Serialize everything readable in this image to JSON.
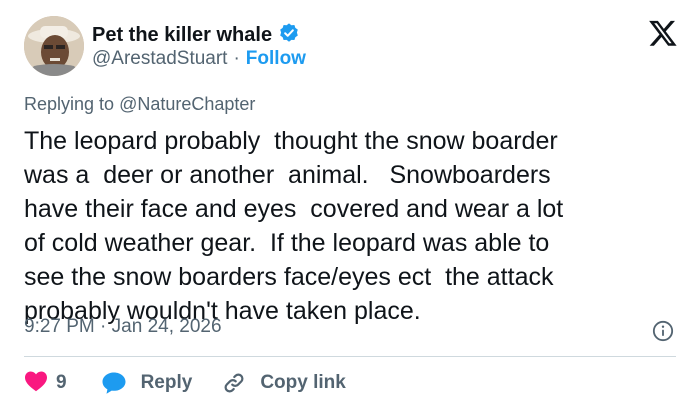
{
  "author": {
    "display_name": "Pet the killer whale",
    "handle": "@ArestadStuart",
    "separator": "·",
    "follow_label": "Follow",
    "verified": true
  },
  "replying": {
    "prefix": "Replying to",
    "mention": "@NatureChapter"
  },
  "tweet": {
    "text": "The leopard probably  thought the snow boarder\nwas a  deer or another  animal.   Snowboarders\nhave their face and eyes  covered and wear a lot\nof cold weather gear.  If the leopard was able to\nsee the snow boarders face/eyes ect  the attack\nprobably wouldn't have taken place.",
    "time": "9:27 PM",
    "date": "Jan 24, 2026",
    "meta_separator": "·"
  },
  "actions": {
    "like_count": "9",
    "reply_label": "Reply",
    "copy_link_label": "Copy link"
  },
  "colors": {
    "accent": "#1d9bf0",
    "like": "#f91880",
    "text": "#0f1419",
    "muted": "#536471"
  },
  "icons": {
    "brand": "x-logo-icon",
    "verified": "verified-badge-icon",
    "info": "info-icon",
    "like": "heart-icon",
    "reply": "reply-bubble-icon",
    "copy": "link-icon"
  }
}
